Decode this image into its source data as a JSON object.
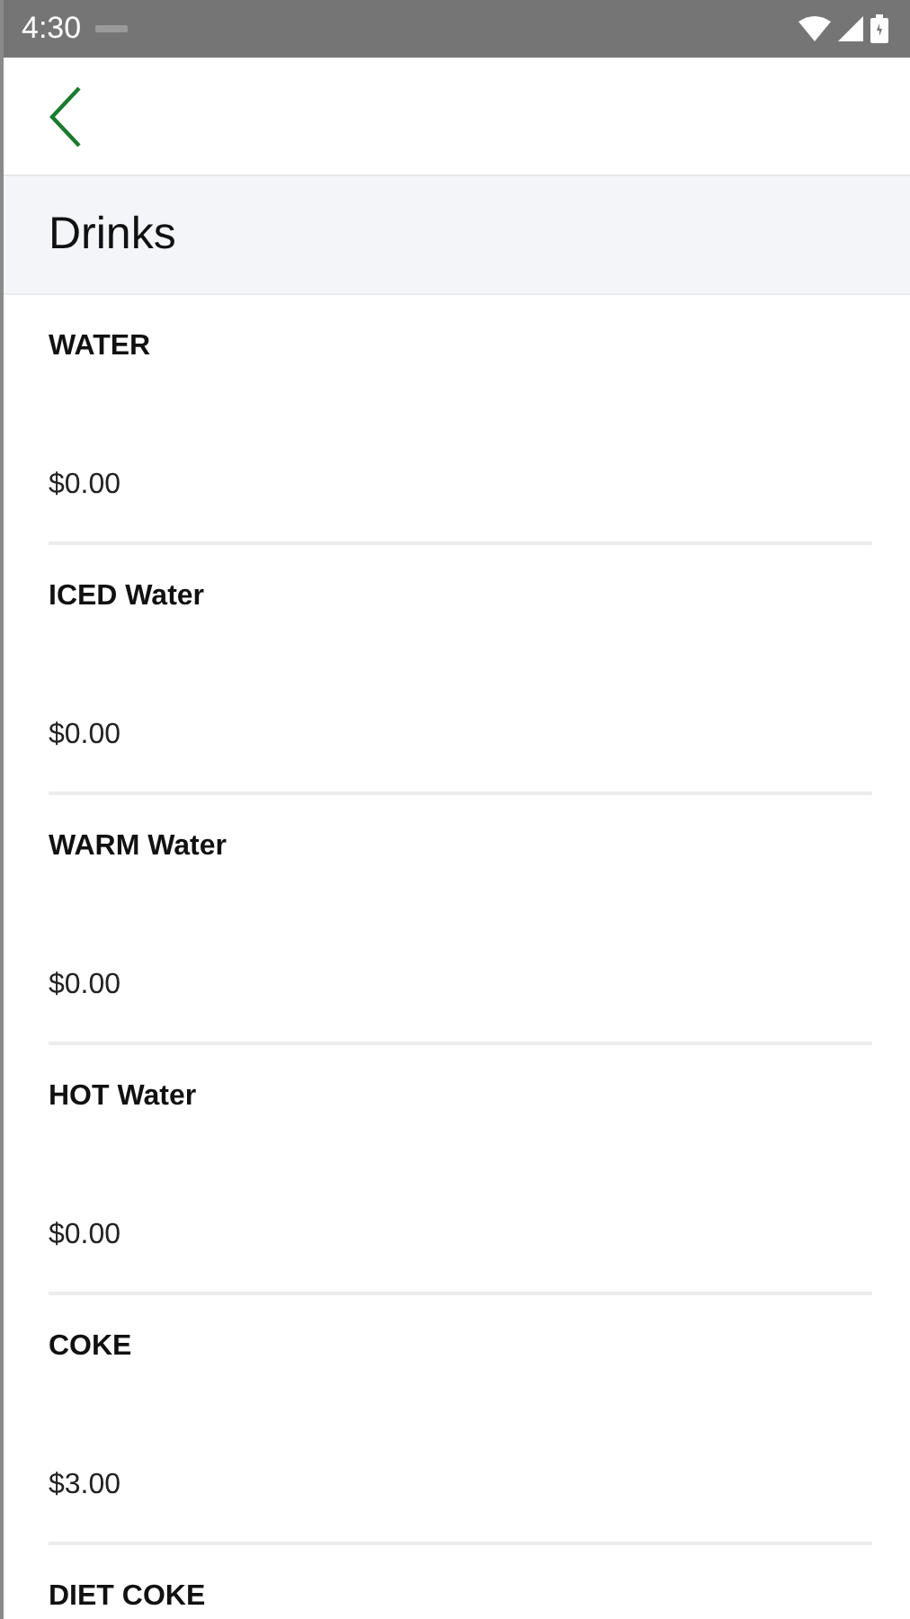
{
  "status_bar": {
    "time": "4:30"
  },
  "section": {
    "title": "Drinks"
  },
  "items": [
    {
      "name": "WATER",
      "price": "$0.00"
    },
    {
      "name": "ICED Water",
      "price": "$0.00"
    },
    {
      "name": "WARM Water",
      "price": "$0.00"
    },
    {
      "name": "HOT Water",
      "price": "$0.00"
    },
    {
      "name": "COKE",
      "price": "$3.00"
    },
    {
      "name": "DIET COKE"
    }
  ]
}
